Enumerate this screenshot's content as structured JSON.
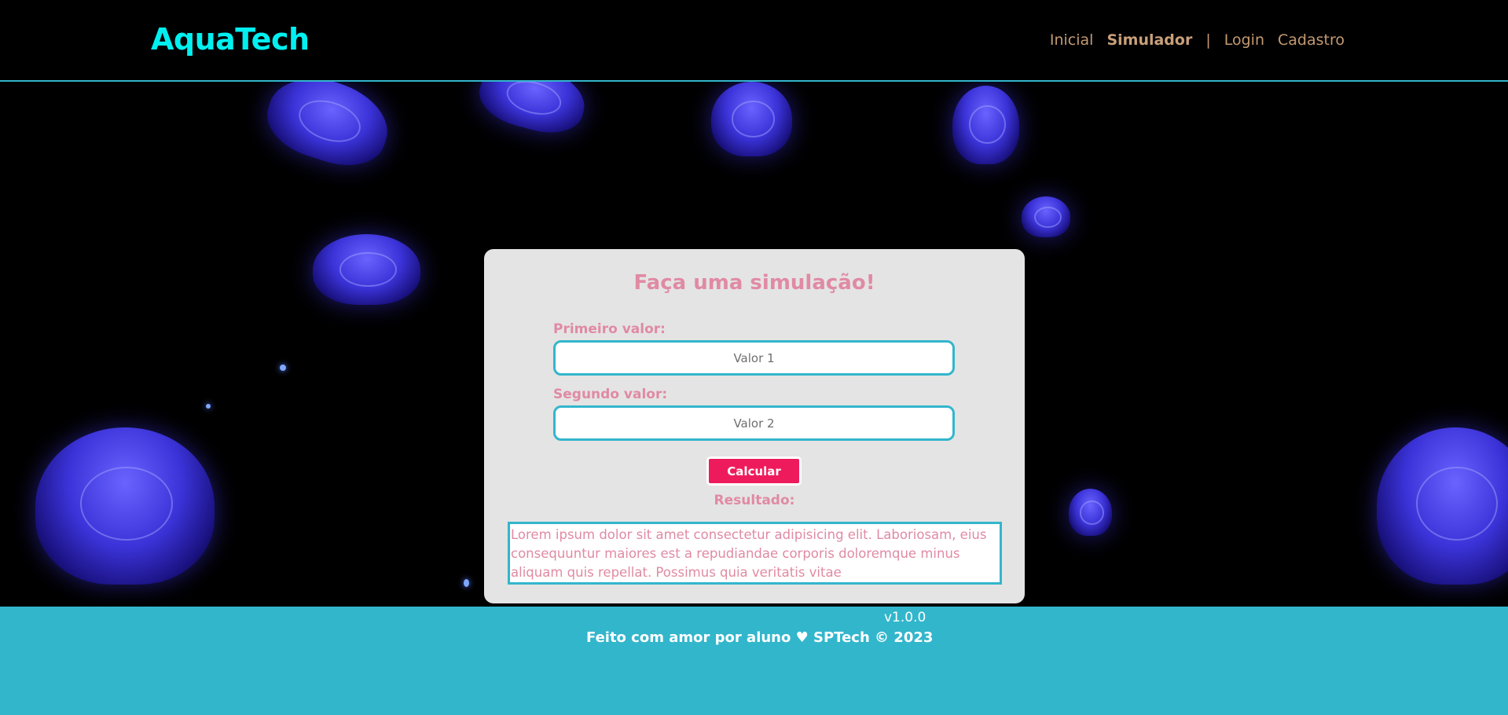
{
  "header": {
    "logo": "AquaTech",
    "nav": {
      "inicial": "Inicial",
      "simulador": "Simulador",
      "separator": "|",
      "login": "Login",
      "cadastro": "Cadastro"
    }
  },
  "simulator": {
    "title": "Faça uma simulação!",
    "first_label": "Primeiro valor:",
    "first_placeholder": "Valor 1",
    "second_label": "Segundo valor:",
    "second_placeholder": "Valor 2",
    "calc_button": "Calcular",
    "result_label": "Resultado:",
    "result_text": "Lorem ipsum dolor sit amet consectetur adipisicing elit. Laboriosam, eius consequuntur maiores est a repudiandae corporis doloremque minus aliquam quis repellat. Possimus quia veritatis vitae"
  },
  "footer": {
    "version": "v1.0.0",
    "credits": "Feito com amor por aluno ♥ SPTech © 2023"
  },
  "colors": {
    "accent": "#32b6cc",
    "logo": "#00f0f0",
    "nav": "#c49a72",
    "pink": "#e08aa4",
    "button": "#ee1b5c",
    "card": "#e4e4e4"
  },
  "hero_background": "jellyfish-image"
}
